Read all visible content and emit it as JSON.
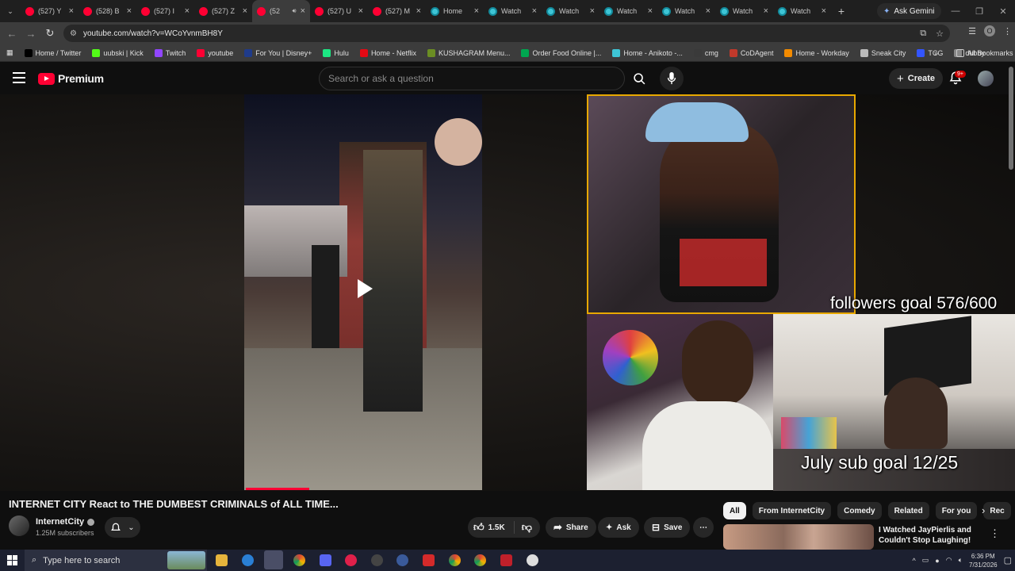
{
  "tabs": [
    {
      "label": "(527) Y",
      "icon": "youtube-favicon"
    },
    {
      "label": "(528) B",
      "icon": "youtube-favicon"
    },
    {
      "label": "(527) I",
      "icon": "youtube-favicon"
    },
    {
      "label": "(527) Z",
      "icon": "youtube-favicon"
    },
    {
      "label": "(52",
      "icon": "youtube-favicon",
      "active": true
    },
    {
      "label": "(527) U",
      "icon": "youtube-favicon"
    },
    {
      "label": "(527) M",
      "icon": "youtube-favicon"
    },
    {
      "label": "Home",
      "icon": "prime-favicon"
    },
    {
      "label": "Watch",
      "icon": "prime-favicon"
    },
    {
      "label": "Watch",
      "icon": "prime-favicon"
    },
    {
      "label": "Watch",
      "icon": "prime-favicon"
    },
    {
      "label": "Watch",
      "icon": "prime-favicon"
    },
    {
      "label": "Watch",
      "icon": "prime-favicon"
    },
    {
      "label": "Watch",
      "icon": "prime-favicon"
    }
  ],
  "gemini_label": "Ask Gemini",
  "address": "youtube.com/watch?v=WCoYvnmBH8Y",
  "profile_initial": "O",
  "bookmarks": [
    {
      "label": "Home / Twitter",
      "color": "#000000"
    },
    {
      "label": "uubski | Kick",
      "color": "#53fc18"
    },
    {
      "label": "Twitch",
      "color": "#9146ff"
    },
    {
      "label": "youtube",
      "color": "#ff0033"
    },
    {
      "label": "For You | Disney+",
      "color": "#1f3b8a"
    },
    {
      "label": "Hulu",
      "color": "#1ce783"
    },
    {
      "label": "Home - Netflix",
      "color": "#e50914"
    },
    {
      "label": "KUSHAGRAM Menu...",
      "color": "#6b8e23"
    },
    {
      "label": "Order Food Online |...",
      "color": "#00a650"
    },
    {
      "label": "Home - Anikoto -...",
      "color": "#3ec5d6"
    },
    {
      "label": "cmg",
      "color": "#3a3a3a"
    },
    {
      "label": "CoDAgent",
      "color": "#c0392b"
    },
    {
      "label": "Home - Workday",
      "color": "#f38b00"
    },
    {
      "label": "Sneak City",
      "color": "#bbbbbb"
    },
    {
      "label": "TCG",
      "color": "#3355ff"
    },
    {
      "label": "dubby",
      "color": "#888888"
    }
  ],
  "all_bookmarks": "All Bookmarks",
  "yt": {
    "logo_text": "Premium",
    "search_placeholder": "Search or ask a question",
    "create_label": "Create",
    "notif_badge": "9+"
  },
  "video": {
    "overlay_followers": "followers goal 576/600",
    "overlay_subs": "July sub goal 12/25",
    "title": "INTERNET CITY React to THE DUMBEST CRIMINALS of ALL TIME...",
    "channel": "InternetCity",
    "subscribers": "1.25M subscribers",
    "likes": "1.5K",
    "share_label": "Share",
    "ask_label": "Ask",
    "save_label": "Save"
  },
  "chips": [
    "All",
    "From InternetCity",
    "Comedy",
    "Related",
    "For you",
    "Rec"
  ],
  "recommendation": {
    "title": "I Watched JayPierlis and Couldn't Stop Laughing!"
  },
  "taskbar": {
    "search_placeholder": "Type here to search",
    "time": "6:36 PM",
    "date": "7/31/2026"
  }
}
